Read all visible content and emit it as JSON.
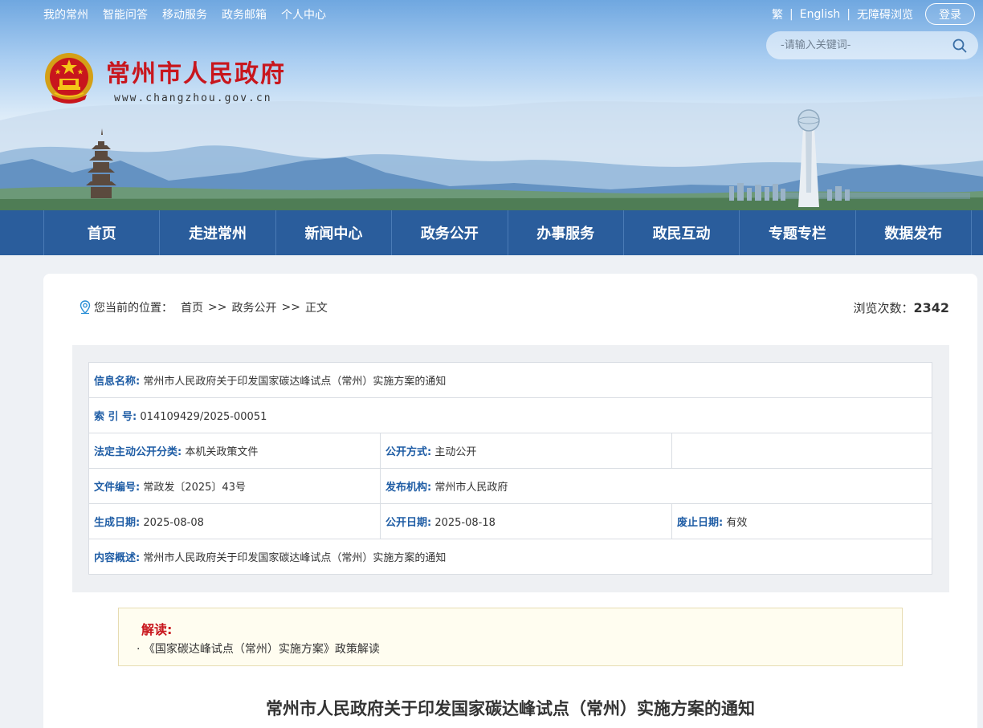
{
  "top_links_left": [
    "我的常州",
    "智能问答",
    "移动服务",
    "政务邮箱",
    "个人中心"
  ],
  "top_links_right": {
    "traditional": "繁",
    "english": "English",
    "accessible": "无障碍浏览",
    "separator": "|"
  },
  "login_label": "登录",
  "search": {
    "placeholder": "-请输入关键词-"
  },
  "site": {
    "name": "常州市人民政府",
    "domain": "www.changzhou.gov.cn"
  },
  "nav": [
    "首页",
    "走进常州",
    "新闻中心",
    "政务公开",
    "办事服务",
    "政民互动",
    "专题专栏",
    "数据发布"
  ],
  "breadcrumb": {
    "prefix": "您当前的位置：",
    "items": [
      "首页",
      "政务公开",
      "正文"
    ],
    "separator": ">>"
  },
  "views": {
    "label": "浏览次数：",
    "count": "2342"
  },
  "info": {
    "name_label": "信息名称:",
    "name_value": "常州市人民政府关于印发国家碳达峰试点（常州）实施方案的通知",
    "index_label": "索 引 号:",
    "index_value": "014109429/2025-00051",
    "category_label": "法定主动公开分类:",
    "category_value": "本机关政策文件",
    "open_mode_label": "公开方式:",
    "open_mode_value": "主动公开",
    "doc_no_label": "文件编号:",
    "doc_no_value": "常政发〔2025〕43号",
    "publisher_label": "发布机构:",
    "publisher_value": "常州市人民政府",
    "created_label": "生成日期:",
    "created_value": "2025-08-08",
    "published_label": "公开日期:",
    "published_value": "2025-08-18",
    "expiry_label": "废止日期:",
    "expiry_value": "有效",
    "summary_label": "内容概述:",
    "summary_value": "常州市人民政府关于印发国家碳达峰试点（常州）实施方案的通知"
  },
  "interpretation": {
    "title": "解读:",
    "items": [
      "· 《国家碳达峰试点（常州）实施方案》政策解读"
    ]
  },
  "document_title": "常州市人民政府关于印发国家碳达峰试点（常州）实施方案的通知",
  "colors": {
    "nav_bg": "#2a5d9c",
    "brand_red": "#c8161d",
    "label_blue": "#1f5da5"
  }
}
